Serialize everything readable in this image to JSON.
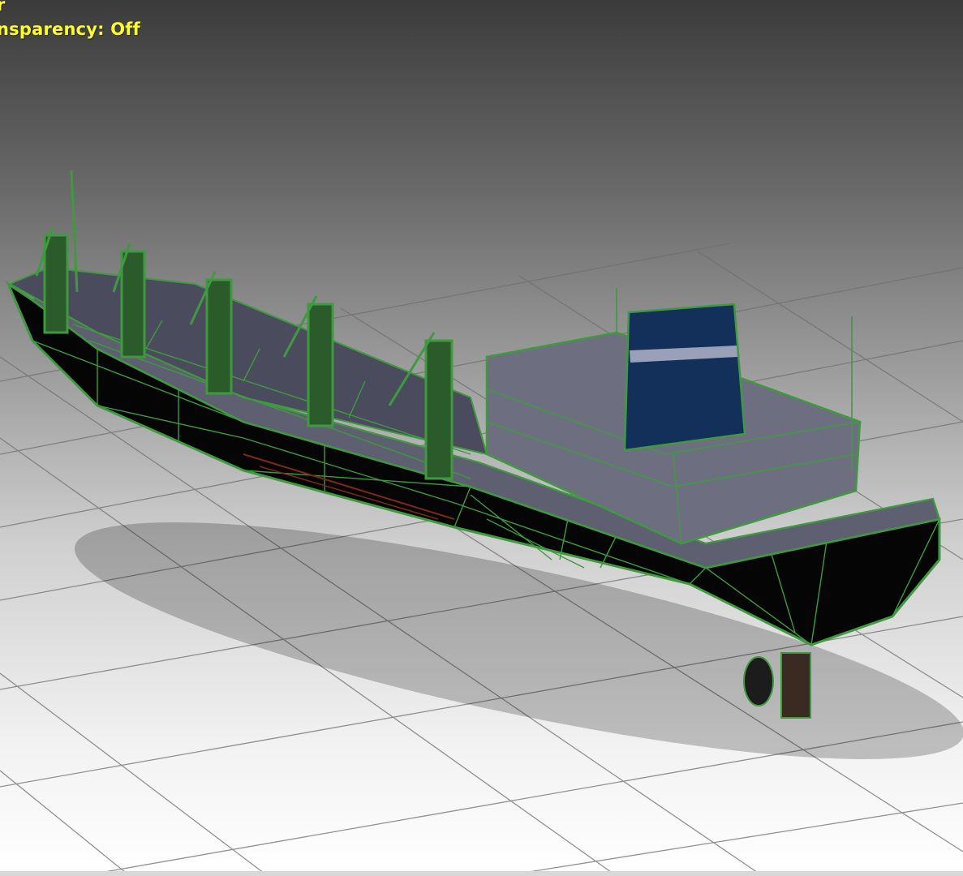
{
  "viewport": {
    "overlay_line_1": "r",
    "overlay_line_2": "nsparency: Off",
    "overlay_color": "#ffff2a"
  },
  "scene": {
    "object": "cargo-ship-model",
    "wire_color": "#3f9a3f",
    "hull_color": "#050505",
    "deck_color": "#6a6a80",
    "funnel_color": "#12305a"
  }
}
